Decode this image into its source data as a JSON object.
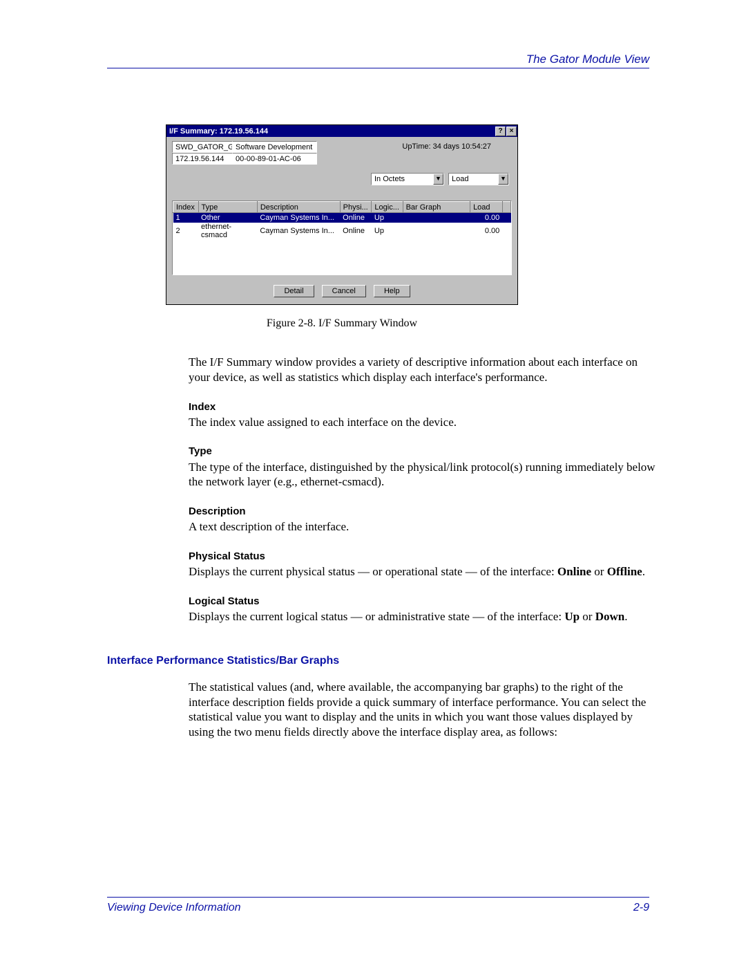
{
  "header": {
    "right": "The Gator Module View"
  },
  "window": {
    "title": "I/F Summary: 172.19.56.144",
    "field1": "SWD_GATOR_GB",
    "field2": "Software Development",
    "ip": "172.19.56.144",
    "mac": "00-00-89-01-AC-06",
    "uptime_label": "UpTime: 34 days 10:54:27",
    "dropdown_stat": "In Octets",
    "dropdown_unit": "Load",
    "columns": {
      "index": "Index",
      "type": "Type",
      "description": "Description",
      "physi": "Physi...",
      "logic": "Logic...",
      "bargraph": "Bar Graph",
      "load": "Load"
    },
    "rows": [
      {
        "index": "1",
        "type": "Other",
        "desc": "Cayman Systems In...",
        "physi": "Online",
        "logic": "Up",
        "bar": "",
        "load": "0.00"
      },
      {
        "index": "2",
        "type": "ethernet-csmacd",
        "desc": "Cayman Systems In...",
        "physi": "Online",
        "logic": "Up",
        "bar": "",
        "load": "0.00"
      }
    ],
    "buttons": {
      "detail": "Detail",
      "cancel": "Cancel",
      "help": "Help"
    }
  },
  "caption": "Figure 2-8. I/F Summary Window",
  "intro": "The I/F Summary window provides a variety of descriptive information about each interface on your device, as well as statistics which display each interface's performance.",
  "defs": {
    "index_t": "Index",
    "index_d": "The index value assigned to each interface on the device.",
    "type_t": "Type",
    "type_d": "The type of the interface, distinguished by the physical/link protocol(s) running immediately below the network layer (e.g., ethernet-csmacd).",
    "desc_t": "Description",
    "desc_d": "A text description of the interface.",
    "phys_t": "Physical Status",
    "phys_d_a": "Displays the current physical status — or operational state — of the interface: ",
    "phys_d_b": "Online",
    "phys_d_c": " or ",
    "phys_d_d": "Offline",
    "phys_d_e": ".",
    "log_t": "Logical Status",
    "log_d_a": "Displays the current logical status — or administrative state — of the interface: ",
    "log_d_b": "Up",
    "log_d_c": " or ",
    "log_d_d": "Down",
    "log_d_e": "."
  },
  "section": "Interface Performance Statistics/Bar Graphs",
  "section_body": "The statistical values (and, where available, the accompanying bar graphs) to the right of the interface description fields provide a quick summary of interface performance. You can select the statistical value you want to display and the units in which you want those values displayed by using the two menu fields directly above the interface display area, as follows:",
  "footer": {
    "left": "Viewing Device Information",
    "right": "2-9"
  }
}
